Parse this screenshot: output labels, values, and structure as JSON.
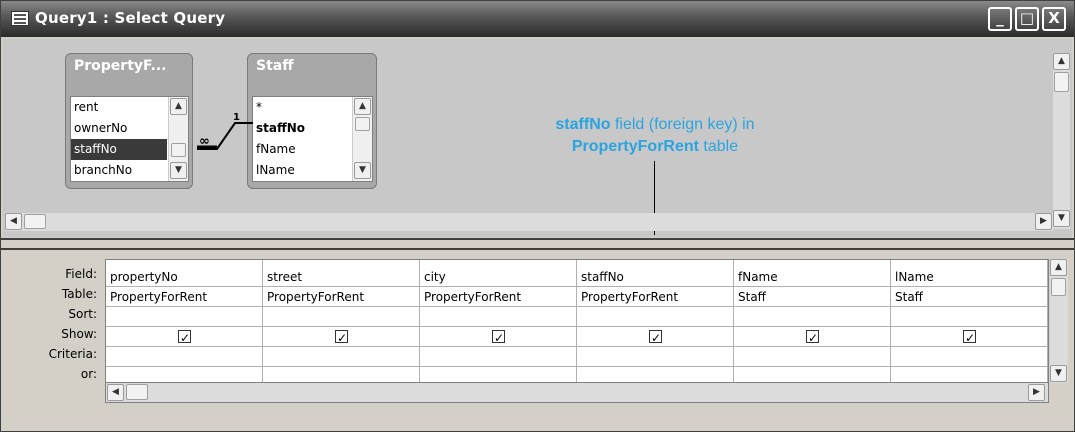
{
  "window": {
    "title": "Query1 : Select Query",
    "controls": {
      "minimize": "_",
      "maximize": "□",
      "close": "X"
    }
  },
  "tables": [
    {
      "name": "PropertyF...",
      "fields": [
        "rent",
        "ownerNo",
        "staffNo",
        "branchNo"
      ],
      "selected": "staffNo"
    },
    {
      "name": "Staff",
      "fields": [
        "*",
        "staffNo",
        "fName",
        "lName"
      ],
      "bold": "staffNo"
    }
  ],
  "relationship": {
    "many_label": "∞",
    "one_label": "1"
  },
  "annotation": {
    "line1_bold": "staffNo",
    "line1_rest": " field (foreign key) in",
    "line2_bold": "PropertyForRent",
    "line2_rest": " table",
    "color": "#2aa4e0"
  },
  "grid": {
    "row_labels": [
      "Field:",
      "Table:",
      "Sort:",
      "Show:",
      "Criteria:",
      "or:"
    ],
    "columns": [
      {
        "field": "propertyNo",
        "table": "PropertyForRent",
        "show": true
      },
      {
        "field": "street",
        "table": "PropertyForRent",
        "show": true
      },
      {
        "field": "city",
        "table": "PropertyForRent",
        "show": true
      },
      {
        "field": "staffNo",
        "table": "PropertyForRent",
        "show": true
      },
      {
        "field": "fName",
        "table": "Staff",
        "show": true
      },
      {
        "field": "lName",
        "table": "Staff",
        "show": true
      }
    ]
  }
}
